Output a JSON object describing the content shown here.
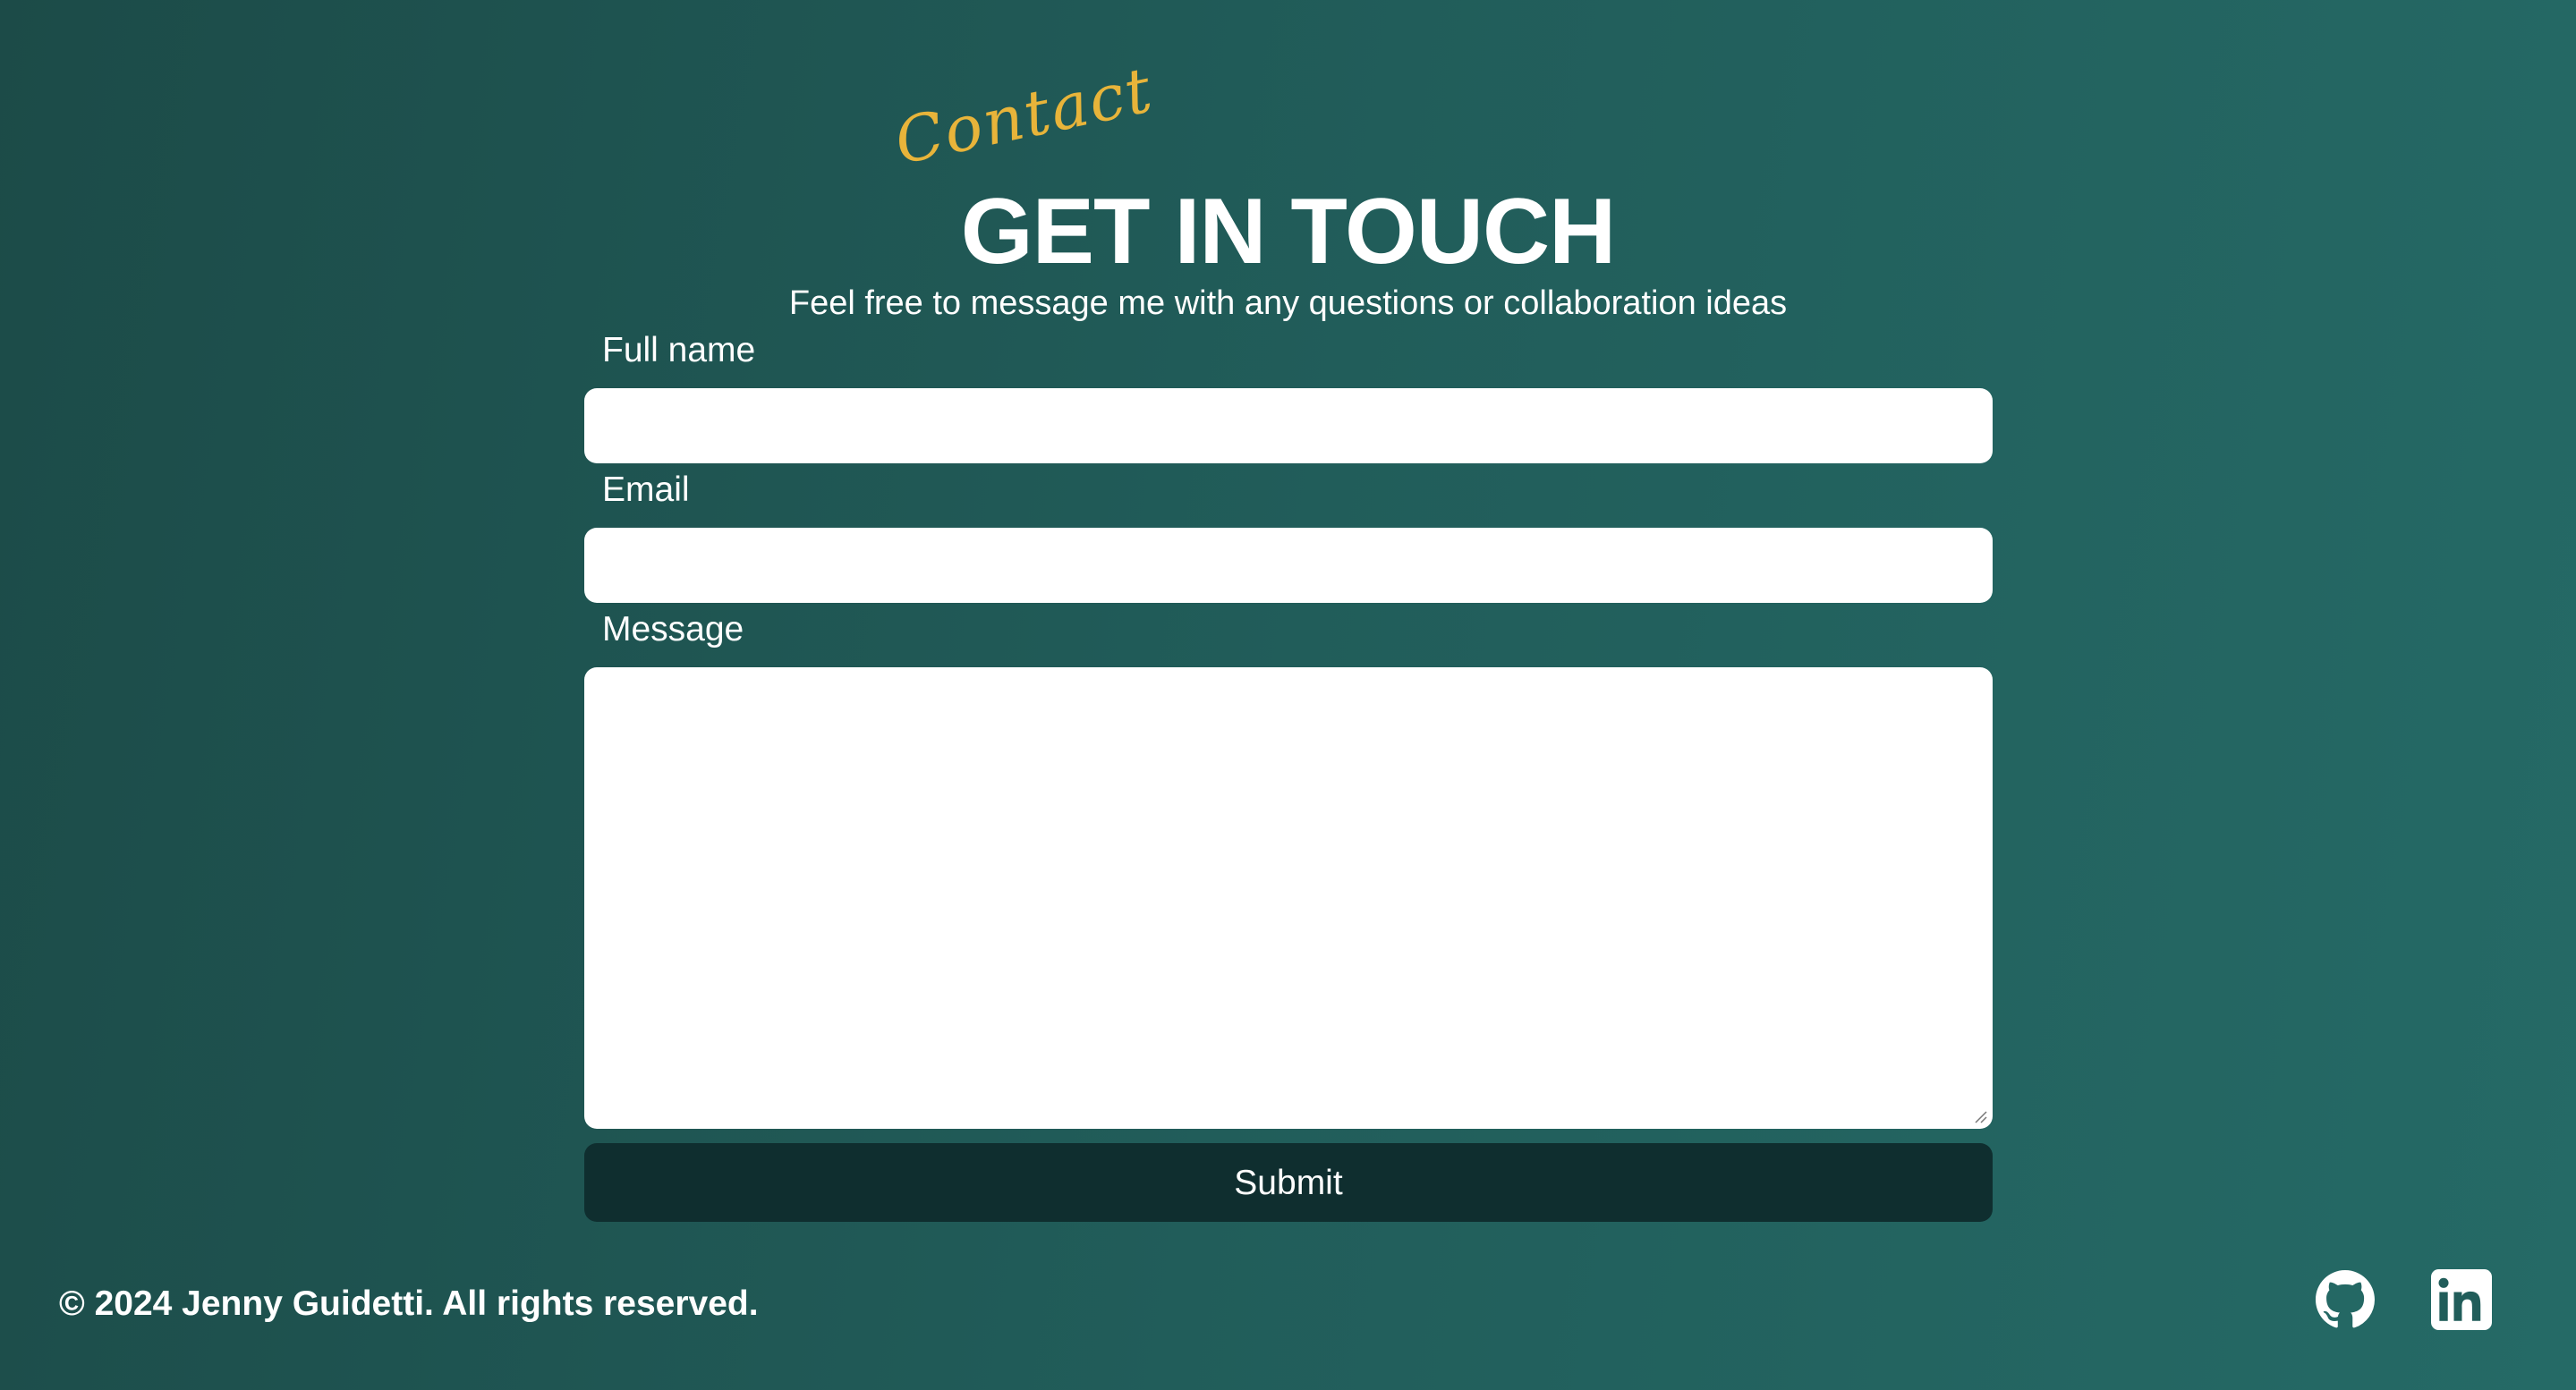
{
  "header": {
    "script_label": "Contact",
    "title": "GET IN TOUCH",
    "subtitle": "Feel free to message me with any questions or collaboration ideas"
  },
  "form": {
    "full_name_label": "Full name",
    "full_name_value": "",
    "email_label": "Email",
    "email_value": "",
    "message_label": "Message",
    "message_value": "",
    "submit_label": "Submit"
  },
  "footer": {
    "copyright": "© 2024 Jenny Guidetti. All rights reserved.",
    "social": [
      {
        "icon": "github-icon"
      },
      {
        "icon": "linkedin-icon"
      }
    ]
  },
  "colors": {
    "background_start": "#1c4b48",
    "background_end": "#256a66",
    "accent_script": "#e8b43a",
    "submit_button": "#0f2e2f"
  }
}
